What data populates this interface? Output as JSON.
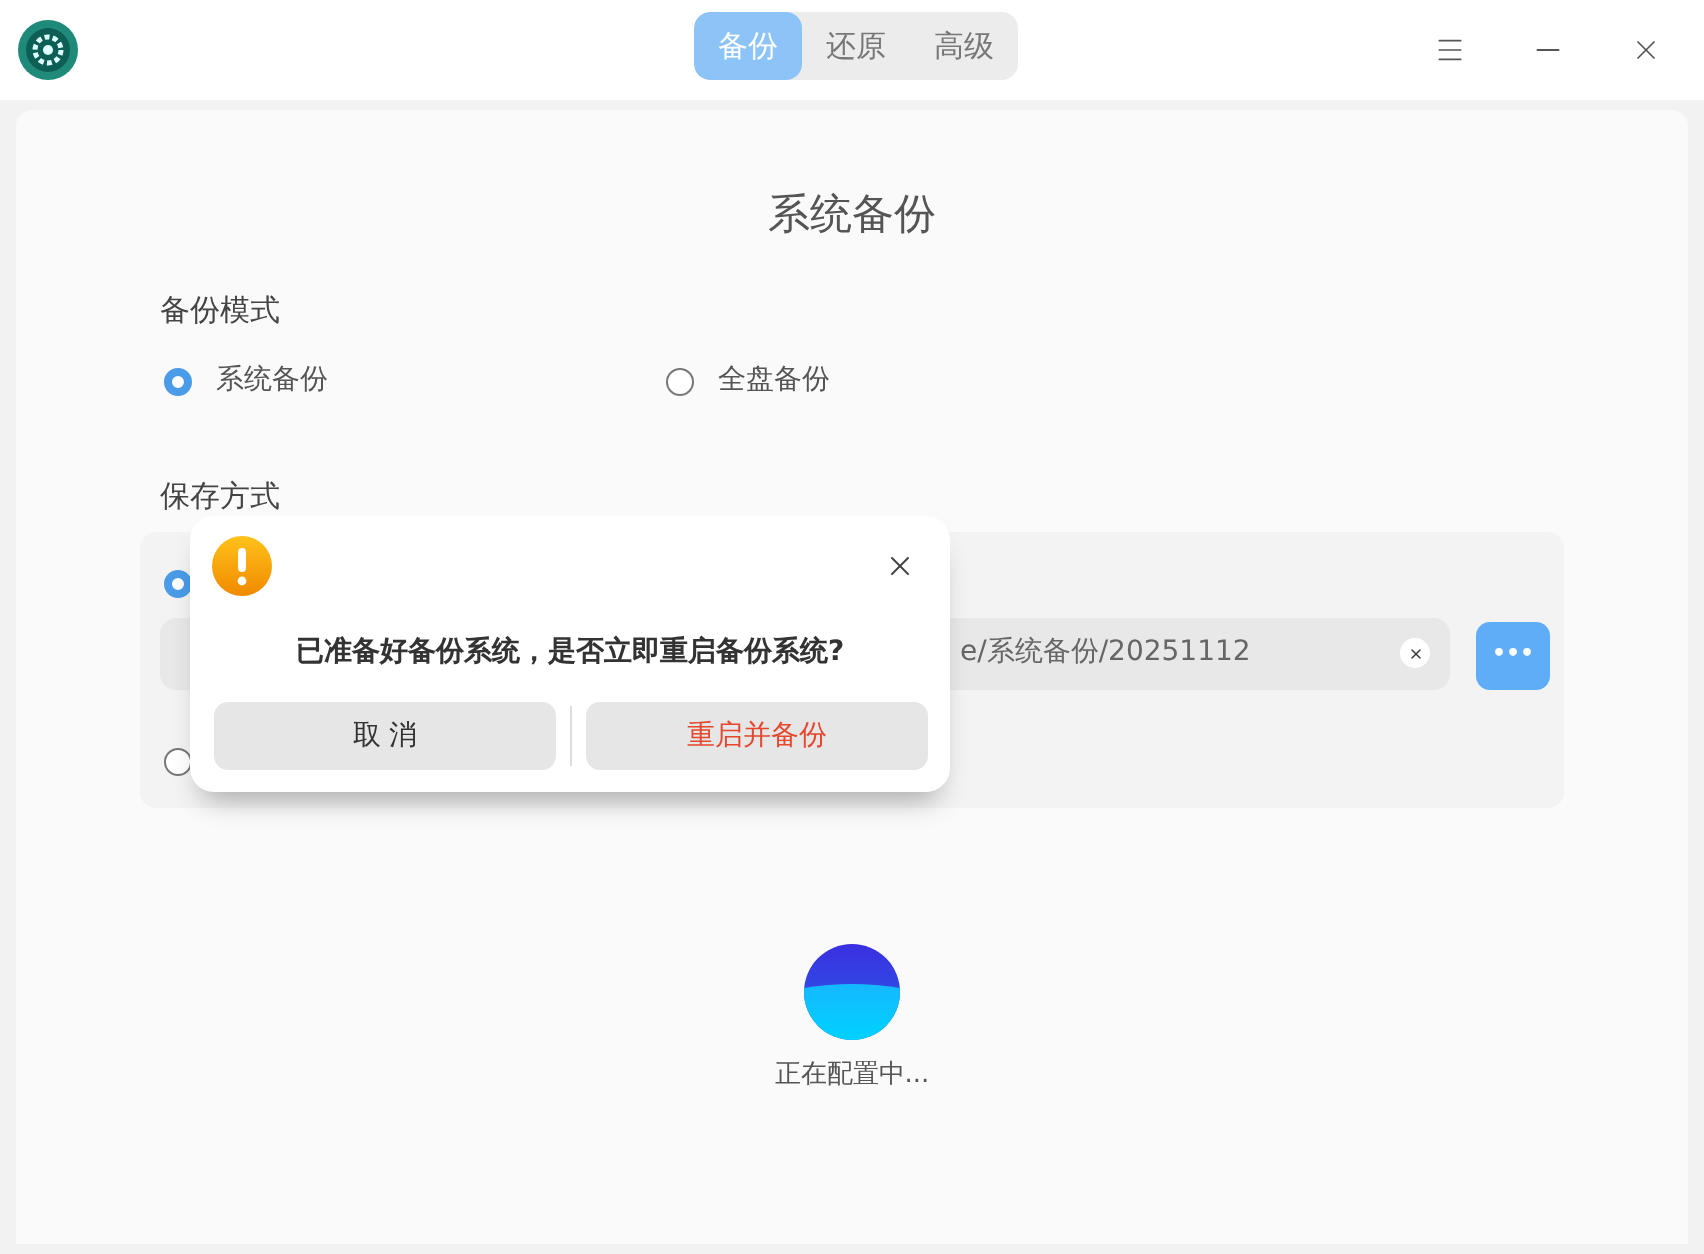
{
  "tabs": [
    {
      "label": "备份",
      "selected": true
    },
    {
      "label": "还原",
      "selected": false
    },
    {
      "label": "高级",
      "selected": false
    }
  ],
  "heading": "系统备份",
  "mode": {
    "label": "备份模式",
    "options": [
      {
        "label": "系统备份",
        "selected": true
      },
      {
        "label": "全盘备份",
        "selected": false
      }
    ]
  },
  "save": {
    "label": "保存方式",
    "options": [
      {
        "selected": true
      },
      {
        "selected": false
      }
    ],
    "path": "e/系统备份/20251112",
    "browse_button": "•••"
  },
  "progress": {
    "text": "正在配置中..."
  },
  "dialog": {
    "message": "已准备好备份系统，是否立即重启备份系统?",
    "buttons": [
      {
        "label": "取 消",
        "kind": "normal"
      },
      {
        "label": "重启并备份",
        "kind": "warning"
      }
    ]
  }
}
